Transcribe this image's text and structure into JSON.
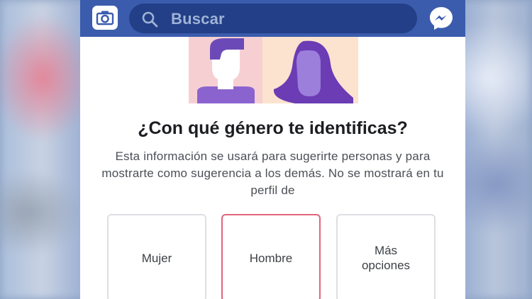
{
  "header": {
    "search_placeholder": "Buscar",
    "icons": {
      "camera": "camera-icon",
      "search": "search-icon",
      "messenger": "messenger-icon"
    },
    "bar_color": "#3b5cad"
  },
  "main": {
    "question": "¿Con qué género te identificas?",
    "explanation": "Esta información se usará para sugerirte personas y para mostrarte como sugerencia a los demás. No se mostrará en tu perfil de",
    "options": [
      {
        "label": "Mujer",
        "selected": false
      },
      {
        "label": "Hombre",
        "selected": true
      },
      {
        "label": "Más opciones",
        "selected": false
      }
    ],
    "selected_color": "#e0667a"
  }
}
